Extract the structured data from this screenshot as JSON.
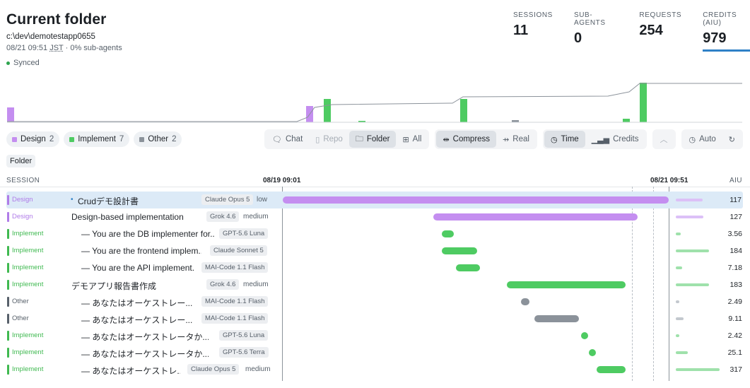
{
  "header": {
    "title": "Current folder",
    "path": "c:\\dev\\demotestapp0655",
    "date": "08/21 09:51",
    "tz": "JST",
    "meta_suffix": "· 0% sub-agents",
    "sync_status": "Synced"
  },
  "stats": [
    {
      "label": "SESSIONS",
      "value": "11"
    },
    {
      "label": "SUB-AGENTS",
      "value": "0"
    },
    {
      "label": "REQUESTS",
      "value": "254"
    },
    {
      "label": "CREDITS (AIU)",
      "value": "979"
    }
  ],
  "filters": [
    {
      "label": "Design",
      "count": "2",
      "color": "#c48ef0"
    },
    {
      "label": "Implement",
      "count": "7",
      "color": "#4ecb62"
    },
    {
      "label": "Other",
      "count": "2",
      "color": "#8b929a"
    }
  ],
  "controls": {
    "chat": "Chat",
    "repo": "Repo",
    "folder": "Folder",
    "all": "All",
    "compress": "Compress",
    "real": "Real",
    "time": "Time",
    "credits": "Credits",
    "auto": "Auto"
  },
  "folder_tag": "Folder",
  "columns": {
    "session": "SESSION",
    "start": "08/19 09:01",
    "end": "08/21 09:51",
    "aiu": "AIU"
  },
  "colors": {
    "design": "#c48ef0",
    "implement": "#4ecb62",
    "other": "#8b929a",
    "accent": "#2f81c7"
  },
  "sessions": [
    {
      "cat": "Design",
      "name": "Crudデモ設計書",
      "model": "Claude Opus 5",
      "effort": "low",
      "aiu": "117",
      "start": 0.0,
      "end": 1.0
    },
    {
      "cat": "Design",
      "name": "Design-based implementation",
      "model": "Grok 4.6",
      "effort": "medium",
      "aiu": "127",
      "start": 0.39,
      "end": 0.92
    },
    {
      "cat": "Implement",
      "name": "— You are the DB implementer for...",
      "model": "GPT-5.6 Luna",
      "effort": "",
      "aiu": "3.56",
      "start": 0.412,
      "end": 0.443
    },
    {
      "cat": "Implement",
      "name": "— You are the frontend implem...",
      "model": "Claude Sonnet 5",
      "effort": "",
      "aiu": "184",
      "start": 0.412,
      "end": 0.504
    },
    {
      "cat": "Implement",
      "name": "— You are the API implement...",
      "model": "MAI-Code 1.1 Flash",
      "effort": "",
      "aiu": "7.18",
      "start": 0.449,
      "end": 0.511
    },
    {
      "cat": "Implement",
      "name": "デモアプリ報告書作成",
      "model": "Grok 4.6",
      "effort": "medium",
      "aiu": "183",
      "start": 0.58,
      "end": 0.889
    },
    {
      "cat": "Other",
      "name": "— あなたはオーケストレー...",
      "model": "MAI-Code 1.1 Flash",
      "effort": "",
      "aiu": "2.49",
      "start": 0.617,
      "end": 0.64
    },
    {
      "cat": "Other",
      "name": "— あなたはオーケストレー...",
      "model": "MAI-Code 1.1 Flash",
      "effort": "",
      "aiu": "9.11",
      "start": 0.652,
      "end": 0.768
    },
    {
      "cat": "Implement",
      "name": "— あなたはオーケストレータか...",
      "model": "GPT-5.6 Luna",
      "effort": "",
      "aiu": "2.42",
      "start": 0.773,
      "end": 0.789
    },
    {
      "cat": "Implement",
      "name": "— あなたはオーケストレータか...",
      "model": "GPT-5.6 Terra",
      "effort": "",
      "aiu": "25.1",
      "start": 0.793,
      "end": 0.809
    },
    {
      "cat": "Implement",
      "name": "— あなたはオーケストレ...",
      "model": "Claude Opus 5",
      "effort": "medium",
      "aiu": "317",
      "start": 0.814,
      "end": 0.888
    }
  ]
}
